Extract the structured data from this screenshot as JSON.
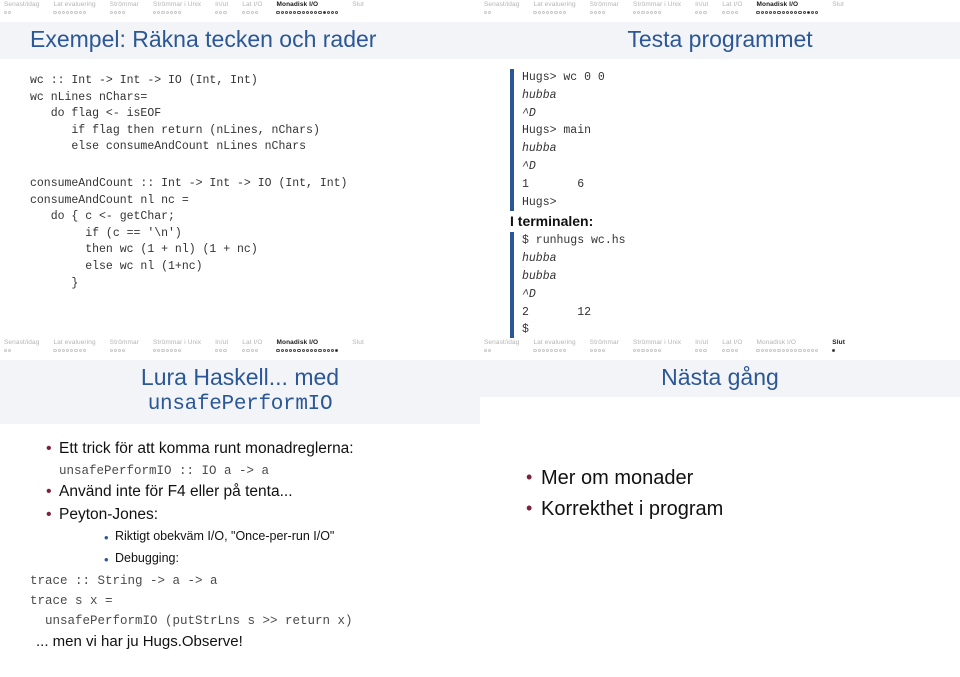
{
  "nav": {
    "sections": [
      {
        "label": "Senast/idag",
        "dots": 2
      },
      {
        "label": "Lat evaluering",
        "dots": 8
      },
      {
        "label": "Strömmar",
        "dots": 4
      },
      {
        "label": "Strömmar i Unix",
        "dots": 7
      },
      {
        "label": "In/ut",
        "dots": 3
      },
      {
        "label": "Lat I/O",
        "dots": 4
      },
      {
        "label": "Monadisk I/O",
        "dots": 15
      },
      {
        "label": "Slut",
        "dots": 0
      }
    ]
  },
  "slides": [
    {
      "title": "Exempel: Räkna tecken och rader",
      "active_section": 6,
      "active_index": 11,
      "code_top": "wc :: Int -> Int -> IO (Int, Int)\nwc nLines nChars=\n   do flag <- isEOF\n      if flag then return (nLines, nChars)\n      else consumeAndCount nLines nChars",
      "code_bottom": "consumeAndCount :: Int -> Int -> IO (Int, Int)\nconsumeAndCount nl nc =\n   do { c <- getChar;\n        if (c == '\\n')\n        then wc (1 + nl) (1 + nc)\n        else wc nl (1+nc)\n      }"
    },
    {
      "title": "Testa programmet",
      "active_section": 6,
      "active_index": 12,
      "terminal_1": [
        {
          "text": "Hugs> wc 0 0",
          "em": false
        },
        {
          "text": "hubba",
          "em": true
        },
        {
          "text": "^D",
          "em": true
        },
        {
          "text": "Hugs> main",
          "em": false
        },
        {
          "text": "hubba",
          "em": true
        },
        {
          "text": "^D",
          "em": true
        },
        {
          "text": "1       6",
          "em": false
        },
        {
          "text": "Hugs>",
          "em": false
        }
      ],
      "terminal_head": "I terminalen:",
      "terminal_2": [
        {
          "text": "$ runhugs wc.hs",
          "em": false
        },
        {
          "text": "hubba",
          "em": true
        },
        {
          "text": "bubba",
          "em": true
        },
        {
          "text": "^D",
          "em": true
        },
        {
          "text": "2       12",
          "em": false
        },
        {
          "text": "$",
          "em": false
        }
      ]
    },
    {
      "title_line1": "Lura Haskell... med",
      "title_line2": "unsafePerformIO",
      "active_section": 6,
      "active_index": 14,
      "bullets": [
        {
          "level": 0,
          "text": "Ett trick för att komma runt monadreglerna:"
        },
        {
          "level": "code",
          "text": "unsafePerformIO :: IO a -> a"
        },
        {
          "level": 0,
          "text": "Använd inte för F4 eller på tenta..."
        },
        {
          "level": 0,
          "text": "Peyton-Jones:"
        },
        {
          "level": 1,
          "text": "Riktigt obekväm I/O, \"Once-per-run I/O\""
        },
        {
          "level": 1,
          "text": "Debugging:"
        }
      ],
      "code_free": "trace :: String -> a -> a\ntrace s x =\n  unsafePerformIO (putStrLns s >> return x)",
      "tail": "... men vi har ju Hugs.Observe!"
    },
    {
      "title": "Nästa gång",
      "active_section": 7,
      "active_index": 0,
      "bullets": [
        {
          "level": 0,
          "text": "Mer om monader"
        },
        {
          "level": 0,
          "text": "Korrekthet i program"
        }
      ]
    }
  ],
  "colors": {
    "title_blue": "#2b5797",
    "bullet_maroon": "#7d2239",
    "sub_bullet_blue": "#2b5797",
    "band_bg": "#f2f4f7",
    "nav_inactive": "#b4b4b4"
  }
}
